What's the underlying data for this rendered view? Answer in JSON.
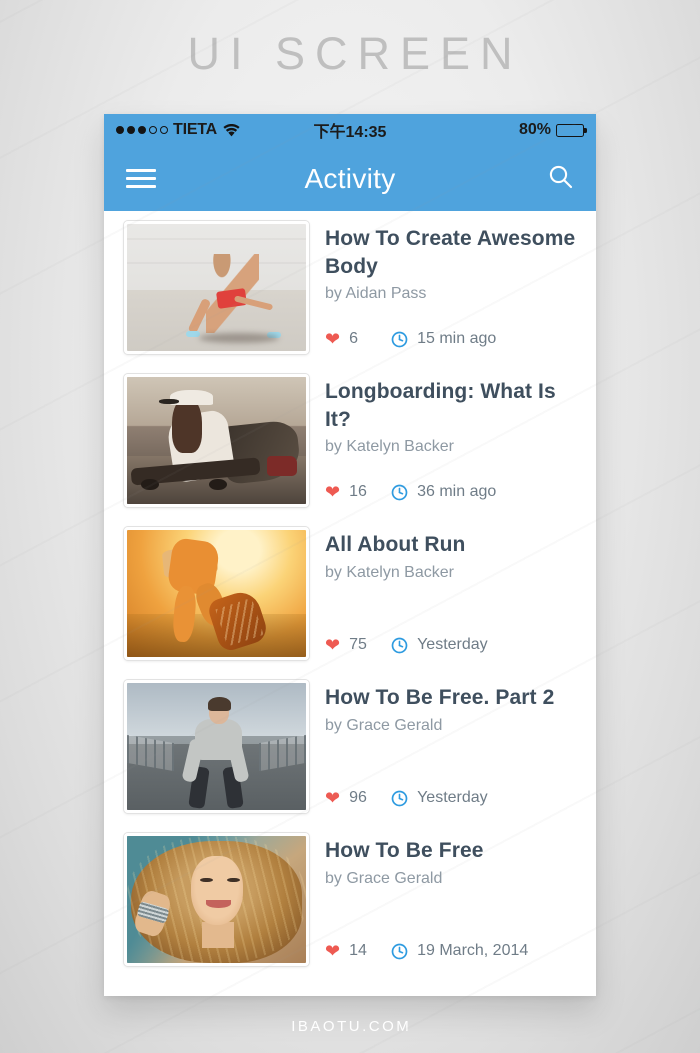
{
  "poster": {
    "title": "UI SCREEN",
    "footer": "IBAOTU.COM"
  },
  "colors": {
    "accent_blue": "#4FA3DD",
    "title_text": "#3F4F5E",
    "author_text": "#8E99A3",
    "heart_red": "#EE5A52",
    "clock_blue": "#2E9BE0",
    "poster_title_gray": "#BFBFBF"
  },
  "statusbar": {
    "signal_dots_filled": 3,
    "signal_dots_hollow": 2,
    "carrier": "TIETA",
    "wifi_icon": "wifi-icon",
    "time": "下午14:35",
    "battery_percent": "80%",
    "battery_level": 80
  },
  "navbar": {
    "menu_icon": "hamburger-menu-icon",
    "title": "Activity",
    "search_icon": "search-icon"
  },
  "feed": {
    "items": [
      {
        "thumb_name": "thumbnail-stretching-woman",
        "title": "How To Create Awesome Body",
        "author": "by Aidan Pass",
        "likes": "6",
        "time": "15 min ago"
      },
      {
        "thumb_name": "thumbnail-longboard-girl",
        "title": "Longboarding: What Is It?",
        "author": "by Katelyn Backer",
        "likes": "16",
        "time": "36 min ago"
      },
      {
        "thumb_name": "thumbnail-sunset-runner",
        "title": "All About Run",
        "author": "by Katelyn Backer",
        "likes": "75",
        "time": "Yesterday"
      },
      {
        "thumb_name": "thumbnail-bridge-runner",
        "title": "How To Be Free. Part 2",
        "author": "by Grace Gerald",
        "likes": "96",
        "time": "Yesterday"
      },
      {
        "thumb_name": "thumbnail-smiling-woman",
        "title": "How To Be Free",
        "author": "by Grace Gerald",
        "likes": "14",
        "time": "19 March, 2014"
      }
    ],
    "heart_icon": "heart-icon",
    "clock_icon": "clock-icon"
  }
}
